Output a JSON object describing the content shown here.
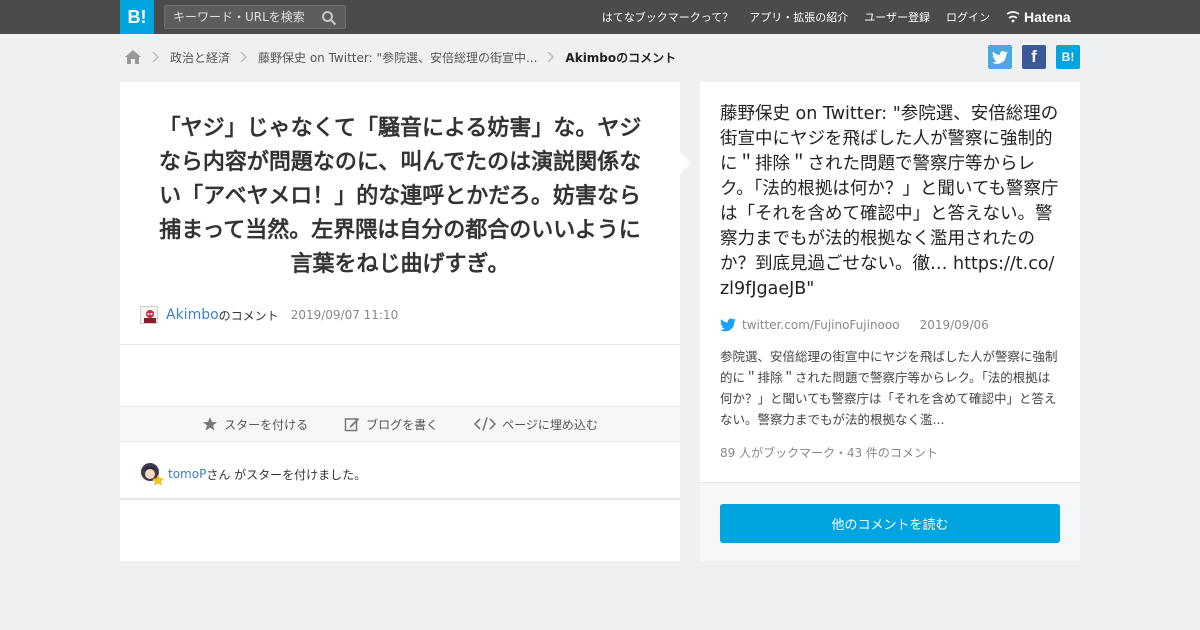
{
  "header": {
    "logo": "B!",
    "search_placeholder": "キーワード・URLを検索",
    "nav": [
      "はてなブックマークって？",
      "アプリ・拡張の紹介",
      "ユーザー登録",
      "ログイン"
    ],
    "brand": "Hatena"
  },
  "breadcrumb": {
    "items": [
      "政治と経済",
      "藤野保史 on Twitter: \"参院選、安倍総理の街宣中...",
      "Akimboのコメント"
    ]
  },
  "share": {
    "facebook": "f",
    "hatena": "B!"
  },
  "comment": {
    "text": "「ヤジ」じゃなくて「騒音による妨害」な。ヤジなら内容が問題なのに、叫んでたのは演説関係ない「アベヤメロ！」的な連呼とかだろ。妨害なら捕まって当然。左界隈は自分の都合のいいように言葉をねじ曲げすぎ。",
    "author": "Akimbo",
    "author_suffix": "のコメント",
    "date": "2019/09/07 11:10"
  },
  "actions": {
    "star": "スターを付ける",
    "blog": "ブログを書く",
    "embed": "ページに埋め込む"
  },
  "star_notice": {
    "user": "tomoP",
    "text": "さん がスターを付けました。"
  },
  "entry": {
    "title": "藤野保史 on Twitter: \"参院選、安倍総理の街宣中にヤジを飛ばした人が警察に強制的に＂排除＂された問題で警察庁等からレク。「法的根拠は何か？」と聞いても警察庁は「それを含めて確認中」と答えない。警察力までもが法的根拠なく濫用されたのか？到底見過ごせない。徹… https://t.co/zl9fJgaeJB\"",
    "source": "twitter.com/FujinoFujinooo",
    "date": "2019/09/06",
    "summary": "参院選、安倍総理の街宣中にヤジを飛ばした人が警察に強制的に＂排除＂された問題で警察庁等からレク。「法的根拠は何か？」と聞いても警察庁は「それを含めて確認中」と答えない。警察力までもが法的根拠なく濫...",
    "counts": "89 人がブックマーク・43 件のコメント",
    "read_more": "他のコメントを読む"
  },
  "colors": {
    "topbar": "#4b4b4b",
    "brand_blue": "#00a4de",
    "link": "#3b82c4",
    "twitter": "#4aa8e0",
    "facebook": "#3b5998"
  }
}
